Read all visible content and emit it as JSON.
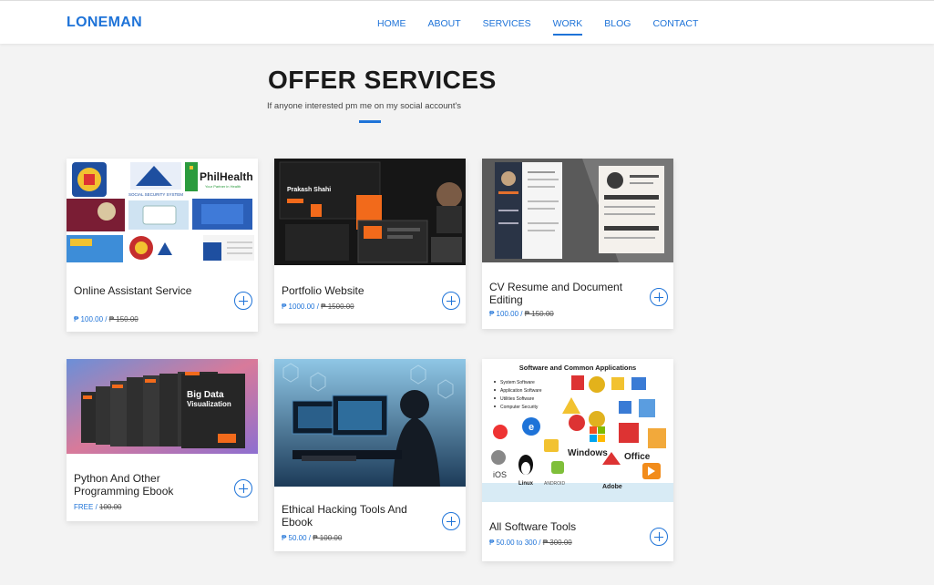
{
  "header": {
    "logo": "LONEMAN",
    "nav": [
      "HOME",
      "ABOUT",
      "SERVICES",
      "WORK",
      "BLOG",
      "CONTACT"
    ],
    "active_nav": "WORK"
  },
  "section": {
    "title": "OFFER SERVICES",
    "subtitle": "If anyone interested pm me on my social account's"
  },
  "thumb_text": {
    "philhealth": "PhilHealth",
    "philhealth_tag": "Your Partner in Health",
    "sss": "SOCIAL SECURITY SYSTEM",
    "portfolio_name": "Prakash Shahi",
    "big_data": "Big Data Visualization",
    "software_title": "Software and Common Applications",
    "software_list": [
      "System Software",
      "Application Software",
      "Utilities Software",
      "Computer Security"
    ],
    "windows": "Windows",
    "office": "Office",
    "adobe": "Adobe",
    "linux": "Linux",
    "ios": "iOS",
    "android": "ANDROID"
  },
  "services": [
    {
      "name": "Online Assistant Service",
      "price": "₱ 100.00",
      "old_price": "₱ 150.00"
    },
    {
      "name": "Portfolio Website",
      "price": "₱ 1000.00",
      "old_price": "₱ 1500.00"
    },
    {
      "name": "CV Resume and Document Editing",
      "price": "₱ 100.00",
      "old_price": "₱ 150.00"
    },
    {
      "name": "Python And Other Programming Ebook",
      "price": "FREE",
      "old_price": "100.00"
    },
    {
      "name": "Ethical Hacking Tools And Ebook",
      "price": "₱ 50.00",
      "old_price": "₱ 100.00"
    },
    {
      "name": "All Software Tools",
      "price": "₱ 50.00 to 300",
      "old_price": "₱ 300.00"
    }
  ],
  "colors": {
    "accent": "#1e73d8",
    "background": "#f3f3f3"
  }
}
